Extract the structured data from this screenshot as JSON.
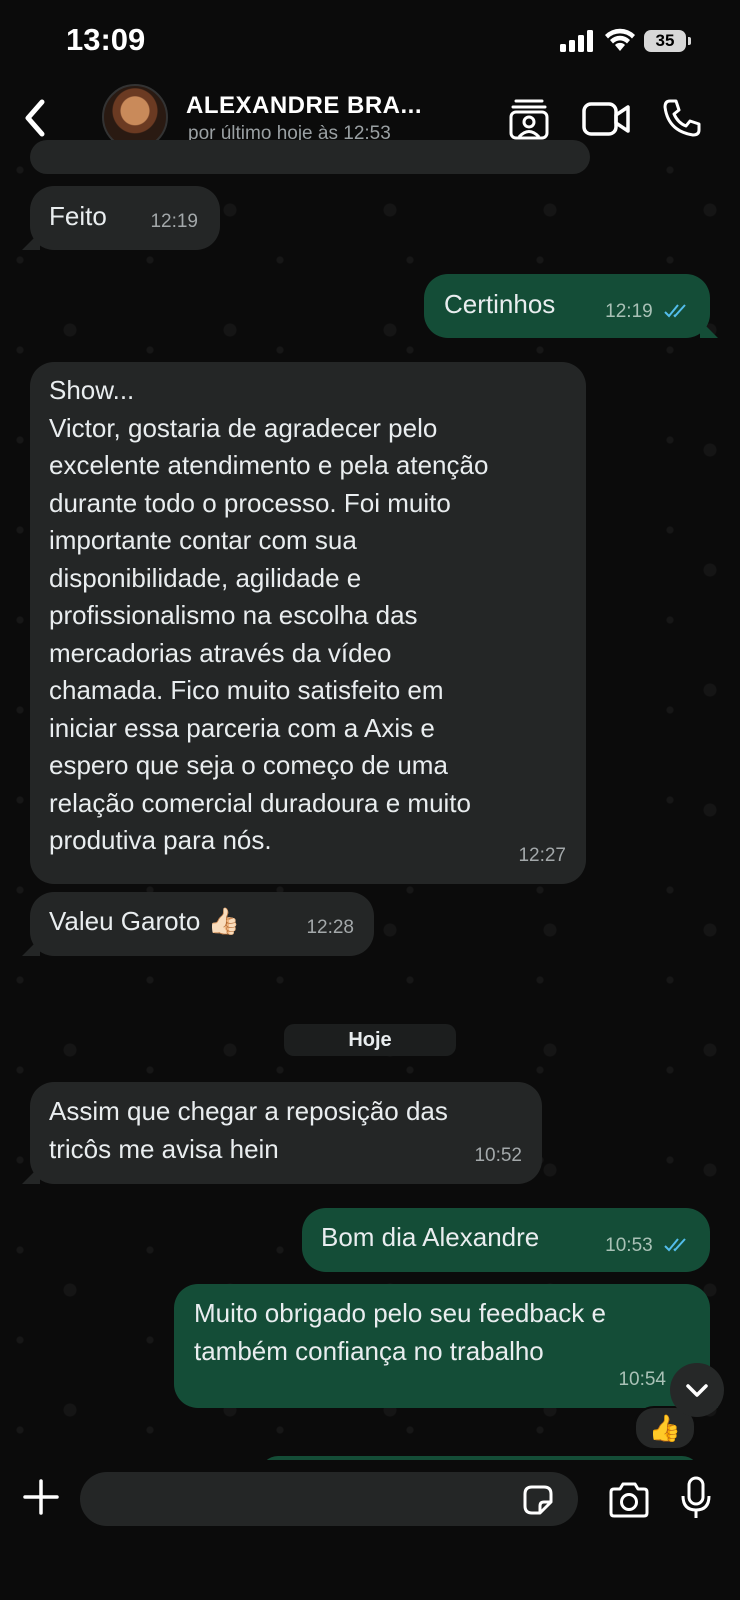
{
  "status_bar": {
    "time": "13:09",
    "battery": "35"
  },
  "header": {
    "contact_name": "ALEXANDRE BRA...",
    "contact_status": "por último hoje às 12:53"
  },
  "messages": [
    {
      "dir": "in",
      "text": "Feito",
      "time": "12:19"
    },
    {
      "dir": "out",
      "text": "Certinhos",
      "time": "12:19",
      "read": true
    },
    {
      "dir": "in",
      "text": "Show...\nVictor, gostaria de agradecer pelo\nexcelente atendimento e pela atenção\ndurante todo o processo. Foi muito\nimportante contar com sua\ndisponibilidade, agilidade e\nprofissionalismo na escolha das\nmercadorias através da vídeo\nchamada. Fico muito satisfeito em\niniciar essa parceria com a Axis e\nespero que seja o começo de uma\nrelação comercial duradoura e muito\nprodutiva para nós.",
      "time": "12:27"
    },
    {
      "dir": "in",
      "text": "Valeu Garoto 👍🏻",
      "time": "12:28"
    },
    {
      "dir": "in",
      "text": "Assim que chegar a reposição das\ntricôs me avisa hein",
      "time": "10:52"
    },
    {
      "dir": "out",
      "text": "Bom dia Alexandre",
      "time": "10:53",
      "read": true
    },
    {
      "dir": "out",
      "text": "Muito obrigado pelo seu feedback e\ntambém confiança no trabalho",
      "time": "10:54",
      "read": true,
      "reaction": "👍"
    }
  ],
  "date_divider": "Hoje",
  "composer": {
    "placeholder": ""
  },
  "colors": {
    "incoming": "#242626",
    "outgoing": "#144d37",
    "tick_read": "#53bdeb",
    "background": "#0b0b0b"
  }
}
